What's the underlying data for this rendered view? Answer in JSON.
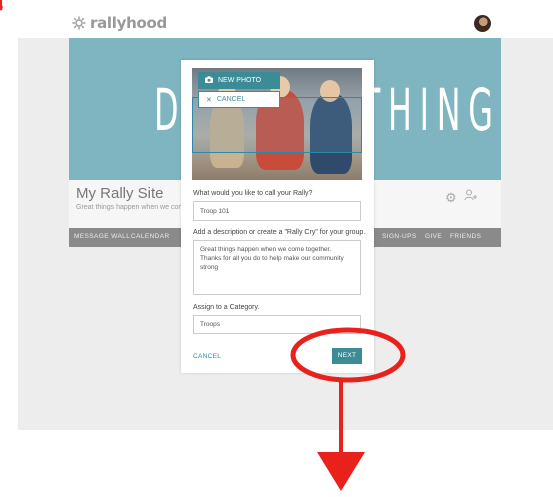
{
  "header": {
    "logo_text": "rallyhood"
  },
  "banner": {
    "text": "DO SOMETHING TODAY"
  },
  "site": {
    "title": "My Rally Site",
    "subtitle": "Great things happen when we come together"
  },
  "nav": {
    "items": [
      "MESSAGE WALL",
      "CALENDAR",
      "SIGN-UPS",
      "GIVE",
      "FRIENDS"
    ]
  },
  "modal": {
    "new_photo_label": "NEW PHOTO",
    "cancel_photo_label": "CANCEL",
    "name_label": "What would you like to call your Rally?",
    "name_value": "Troop 101",
    "desc_label": "Add a description or create a \"Rally Cry\" for your group.",
    "desc_value": "Great things happen when we come together. Thanks for all you do to help make our community strong",
    "category_label": "Assign to a Category.",
    "category_value": "Troops",
    "cancel_label": "CANCEL",
    "next_label": "NEXT"
  },
  "annotations": {
    "accent_color": "#ff0000"
  },
  "colors": {
    "teal": "#3b8c96",
    "banner": "#7eb5c0"
  }
}
